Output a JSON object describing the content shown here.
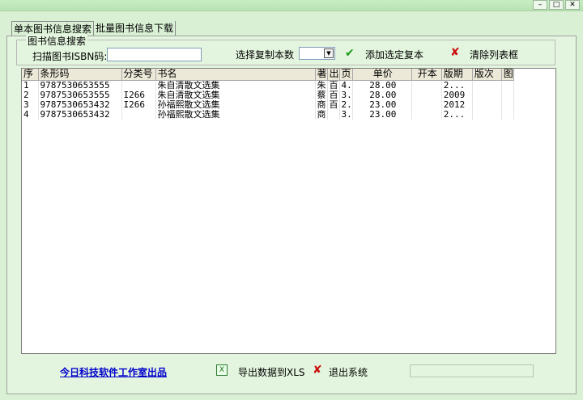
{
  "window": {
    "title_caption": "",
    "min_label": "–",
    "max_label": "□",
    "close_label": "✕"
  },
  "tabs": [
    {
      "label": "单本图书信息搜索"
    },
    {
      "label": "批量图书信息下载"
    }
  ],
  "search_group": {
    "title": "图书信息搜索",
    "isbn_label": "扫描图书ISBN码:",
    "isbn_value": "",
    "copies_label": "选择复制本数",
    "copies_value": "",
    "add_label": "添加选定复本",
    "clear_label": "清除列表框"
  },
  "grid": {
    "columns": [
      "序",
      "条形码",
      "分类号",
      "书名",
      "著",
      "出",
      "页",
      "单价",
      "开本",
      "版期",
      "版次",
      "图"
    ],
    "rows": [
      [
        "1",
        "9787530653555",
        "",
        "朱自清散文选集",
        "朱",
        "百",
        "4.",
        "28.00",
        "",
        "2...",
        "",
        ""
      ],
      [
        "2",
        "9787530653555",
        "I266",
        "朱自清散文选集",
        "蔡",
        "百",
        "3.",
        "28.00",
        "",
        "2009",
        "",
        ""
      ],
      [
        "3",
        "9787530653432",
        "I266",
        "孙福熙散文选集",
        "商",
        "百",
        "2.",
        "23.00",
        "",
        "2012",
        "",
        ""
      ],
      [
        "4",
        "9787530653432",
        "",
        "孙福熙散文选集",
        "商",
        "",
        "3.",
        "23.00",
        "",
        "2...",
        "",
        ""
      ]
    ]
  },
  "footer": {
    "credit": "今日科技软件工作室出品",
    "export_label": "导出数据到XLS",
    "exit_label": "退出系统",
    "status_text": ""
  },
  "icons": {
    "check": "✔",
    "cross": "✘",
    "xls": "X"
  },
  "colors": {
    "background": "#d9f0d4",
    "check": "#1a9a1a",
    "cross": "#cc1111",
    "link": "#0000cc"
  }
}
